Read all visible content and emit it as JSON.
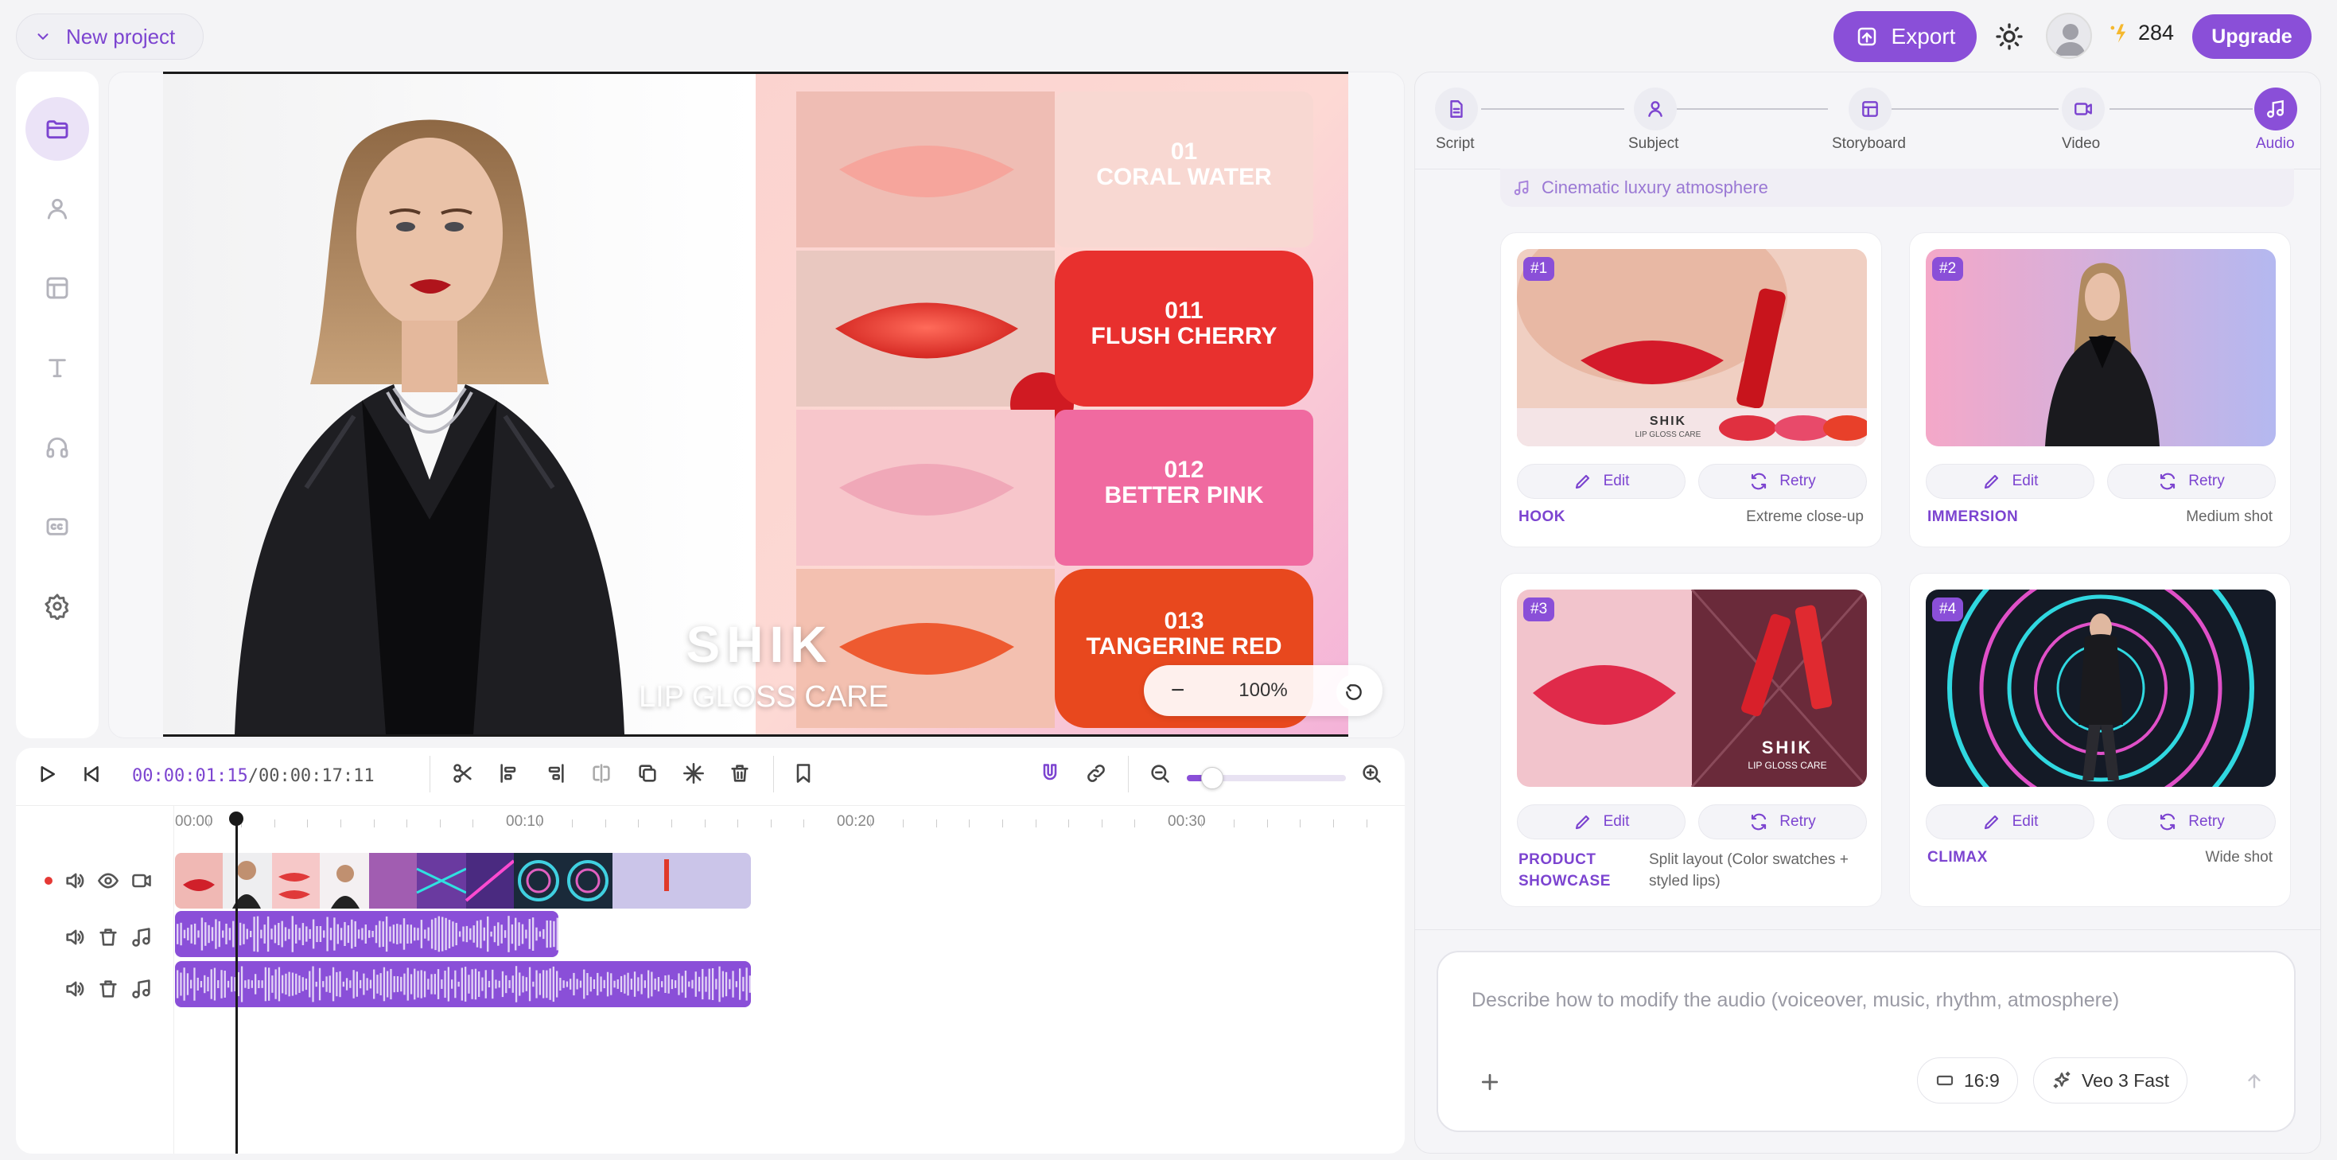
{
  "top": {
    "project_name": "New project",
    "export_label": "Export",
    "credits": "284",
    "upgrade_label": "Upgrade"
  },
  "sidebar": {
    "items": [
      {
        "icon": "folder-icon",
        "active": true
      },
      {
        "icon": "user-icon",
        "active": false
      },
      {
        "icon": "layout-icon",
        "active": false
      },
      {
        "icon": "text-icon",
        "active": false
      },
      {
        "icon": "headphones-icon",
        "active": false
      },
      {
        "icon": "captions-icon",
        "active": false
      },
      {
        "icon": "settings-icon",
        "active": false
      }
    ]
  },
  "preview": {
    "brand": "SHIK",
    "tagline": "LIP GLOSS CARE",
    "swatches": [
      {
        "num": "01",
        "name": "CORAL WATER",
        "color": "#f7c8c0"
      },
      {
        "num": "011",
        "name": "FLUSH CHERRY",
        "color": "#e8302e"
      },
      {
        "num": "012",
        "name": "BETTER PINK",
        "color": "#f06aa0"
      },
      {
        "num": "013",
        "name": "TANGERINE RED",
        "color": "#e8481e"
      }
    ],
    "zoom": "100%"
  },
  "timeline": {
    "current_time": "00:00:01:15",
    "separator": "/",
    "total_time": "00:00:17:11",
    "ruler": [
      "00:00",
      "00:10",
      "00:20",
      "00:30"
    ],
    "playhead_fraction": 0.09
  },
  "right": {
    "steps": [
      {
        "label": "Script",
        "icon": "document-icon"
      },
      {
        "label": "Subject",
        "icon": "user-icon"
      },
      {
        "label": "Storyboard",
        "icon": "layout-icon"
      },
      {
        "label": "Video",
        "icon": "video-icon"
      },
      {
        "label": "Audio",
        "icon": "music-icon"
      }
    ],
    "audio_mood": "Cinematic luxury atmosphere",
    "cards": [
      {
        "badge": "#1",
        "edit": "Edit",
        "retry": "Retry",
        "name": "HOOK",
        "shot": "Extreme close-up",
        "thumb_brand": "SHIK",
        "thumb_tag": "LIP GLOSS CARE"
      },
      {
        "badge": "#2",
        "edit": "Edit",
        "retry": "Retry",
        "name": "IMMERSION",
        "shot": "Medium shot"
      },
      {
        "badge": "#3",
        "edit": "Edit",
        "retry": "Retry",
        "name": "PRODUCT SHOWCASE",
        "shot": "Split layout (Color swatches + styled lips)",
        "thumb_brand": "SHIK",
        "thumb_tag": "LIP GLOSS CARE"
      },
      {
        "badge": "#4",
        "edit": "Edit",
        "retry": "Retry",
        "name": "CLIMAX",
        "shot": "Wide shot"
      }
    ],
    "prompt_placeholder": "Describe how to modify the audio (voiceover, music, rhythm, atmosphere)",
    "aspect": "16:9",
    "model": "Veo 3 Fast"
  },
  "colors": {
    "accent": "#8a4fd8",
    "accent_text": "#7c44d0"
  }
}
